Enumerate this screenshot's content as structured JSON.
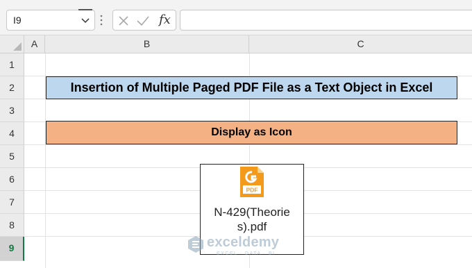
{
  "formula_bar": {
    "name_box_value": "I9",
    "cancel_icon": "x-icon",
    "enter_icon": "check-icon",
    "function_label": "fx",
    "formula_value": ""
  },
  "columns": [
    {
      "key": "A",
      "label": "A"
    },
    {
      "key": "B",
      "label": "B"
    },
    {
      "key": "C",
      "label": "C"
    }
  ],
  "rows": [
    "1",
    "2",
    "3",
    "4",
    "5",
    "6",
    "7",
    "8",
    "9"
  ],
  "selected_row": "9",
  "cells": {
    "title": "Insertion of Multiple Paged PDF File as a Text Object in Excel",
    "subtitle": "Display as Icon"
  },
  "embedded_object": {
    "icon": "pdf-file-icon",
    "icon_badge": "PDF",
    "file_name": "N-429(Theories).pdf"
  },
  "watermark": {
    "brand": "exceldemy",
    "tagline": "EXCEL · DATA · BI"
  },
  "colors": {
    "title_fill": "#bdd7ee",
    "subtitle_fill": "#f4b183",
    "selection_accent": "#107c41",
    "pdf_orange": "#f39a1d"
  }
}
